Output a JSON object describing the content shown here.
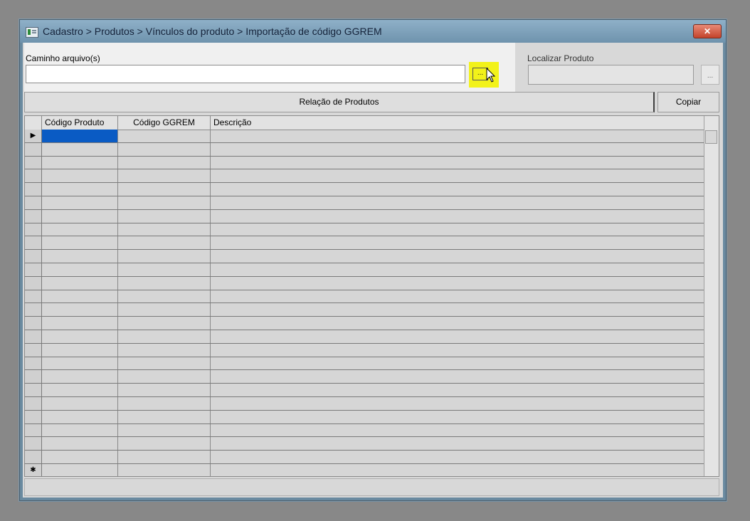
{
  "window": {
    "title": "Cadastro > Produtos > Vínculos do produto > Importação de código GGREM",
    "close_label": "✕"
  },
  "file_path": {
    "label": "Caminho arquivo(s)",
    "value": "",
    "browse_label": "..."
  },
  "product_search": {
    "label": "Localizar Produto",
    "value": "",
    "button_label": "..."
  },
  "product_list": {
    "header_label": "Relação de Produtos",
    "copy_label": "Copiar"
  },
  "grid": {
    "columns": [
      "Código Produto",
      "Código GGREM",
      "Descrição"
    ],
    "current_row_marker": "▶",
    "new_row_marker": "✱"
  },
  "colors": {
    "highlight": "#f2f21a",
    "selection": "#0a5bc4"
  }
}
